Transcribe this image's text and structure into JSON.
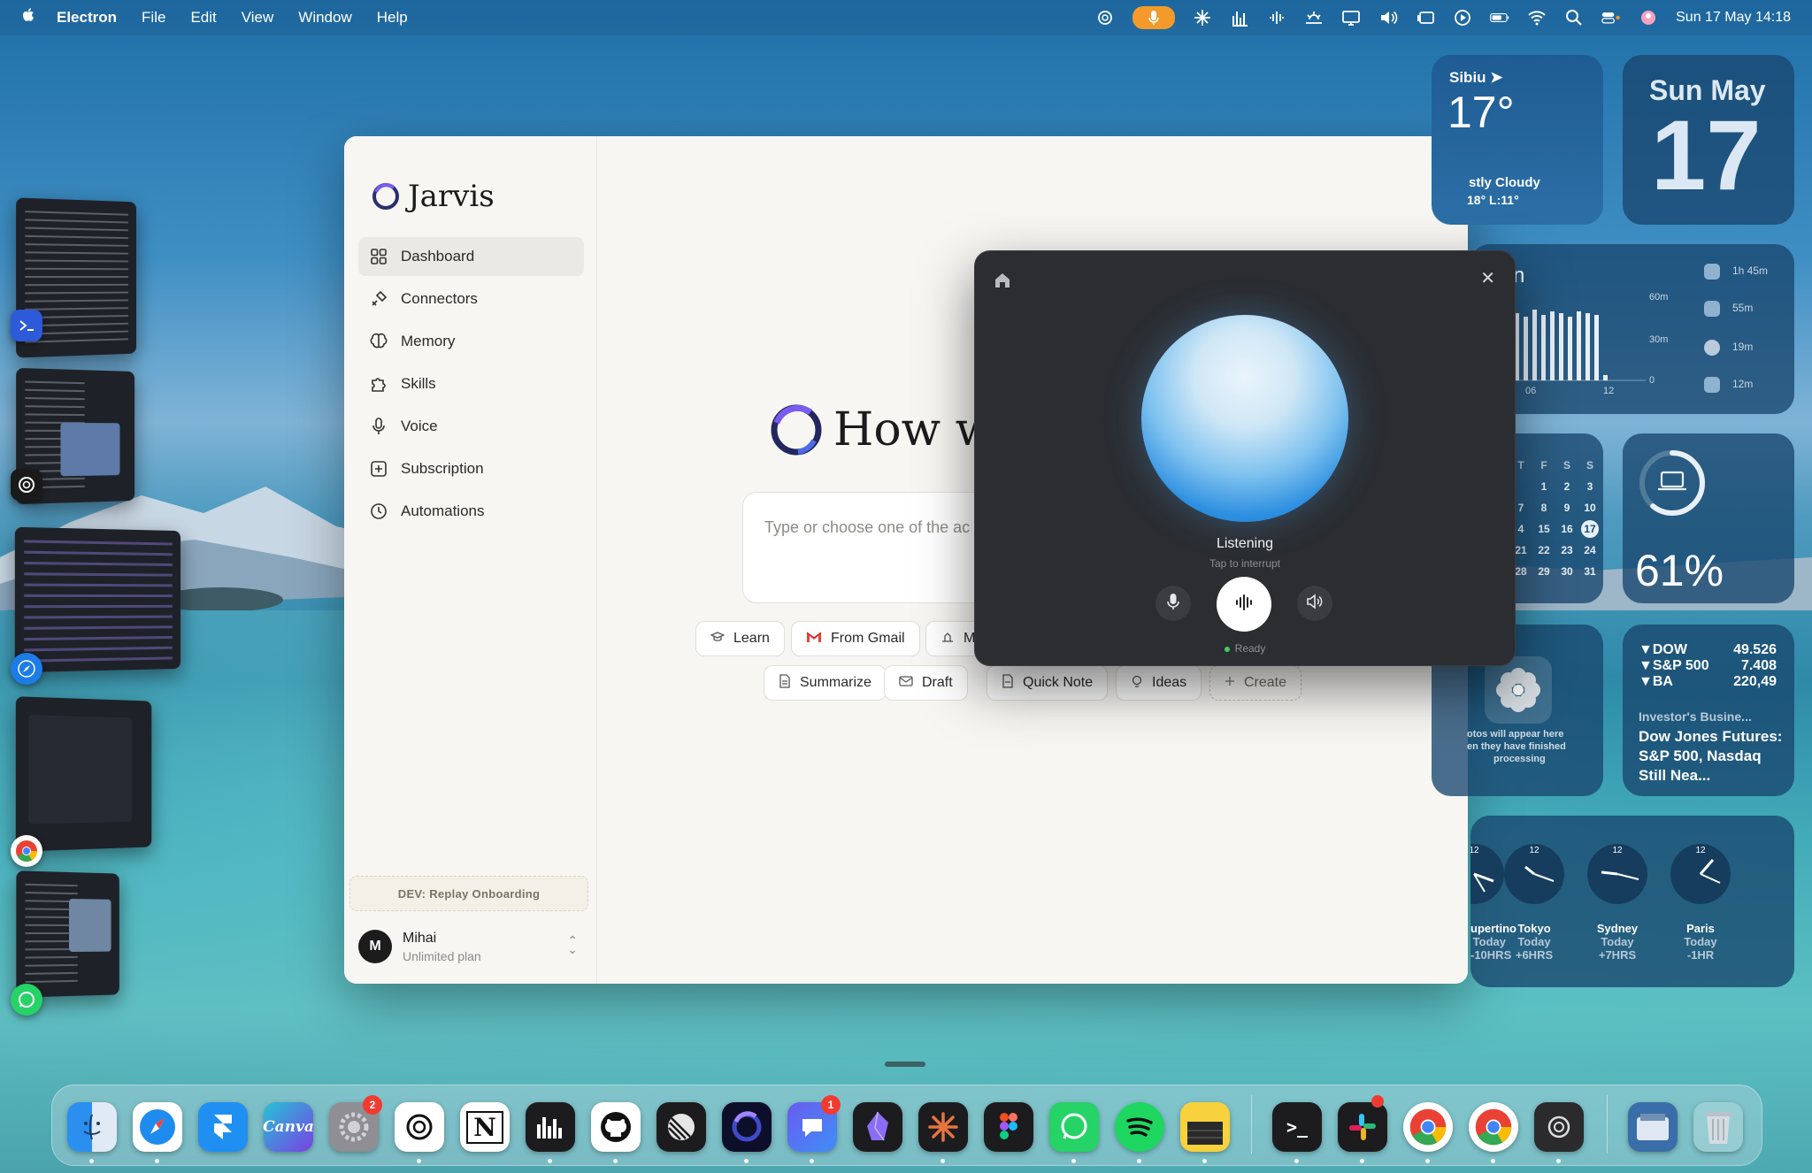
{
  "menubar": {
    "app": "Electron",
    "menus": [
      "File",
      "Edit",
      "View",
      "Window",
      "Help"
    ],
    "datetime": "Sun 17 May  14:18"
  },
  "sidebar": {
    "brand": "Jarvis",
    "items": [
      {
        "label": "Dashboard",
        "icon": "grid-icon"
      },
      {
        "label": "Connectors",
        "icon": "plug-icon"
      },
      {
        "label": "Memory",
        "icon": "brain-icon"
      },
      {
        "label": "Skills",
        "icon": "puzzle-icon"
      },
      {
        "label": "Voice",
        "icon": "microphone-icon"
      },
      {
        "label": "Subscription",
        "icon": "plus-square-icon"
      },
      {
        "label": "Automations",
        "icon": "clock-icon"
      }
    ],
    "dev_button": "DEV: Replay Onboarding",
    "user": {
      "initial": "M",
      "name": "Mihai",
      "plan": "Unlimited plan"
    }
  },
  "main": {
    "hero": "How wa",
    "input_placeholder": "Type or choose one of the ac floatingbar, just like a normal",
    "chips_row1": [
      "Learn",
      "From Gmail",
      "M"
    ],
    "chips_row2": [
      "Summarize",
      "Draft",
      "Quick Note",
      "Ideas",
      "Create"
    ]
  },
  "voice_panel": {
    "status": "Listening",
    "hint": "Tap to interrupt",
    "ready": "Ready"
  },
  "widgets": {
    "weather": {
      "city": "Sibiu",
      "temp": "17°",
      "cond": "stly Cloudy",
      "range": "18° L:11°"
    },
    "date": {
      "month": "Sun May",
      "day": "17"
    },
    "screentime": {
      "title": "n",
      "scale": [
        "60m",
        "30m",
        "0"
      ],
      "hours": [
        "06",
        "12"
      ],
      "apps": [
        "1h 45m",
        "55m",
        "19m",
        "12m"
      ]
    },
    "calendar": {
      "head": [
        "T",
        "F",
        "S",
        "S"
      ],
      "rows": [
        [
          "",
          "1",
          "2",
          "3"
        ],
        [
          "7",
          "8",
          "9",
          "10"
        ],
        [
          "4",
          "15",
          "16",
          "17"
        ],
        [
          "21",
          "22",
          "23",
          "24"
        ],
        [
          "28",
          "29",
          "30",
          "31"
        ]
      ],
      "today": "17"
    },
    "battery": {
      "pct": "61%",
      "level": 0.61
    },
    "photos": {
      "line1": "otos will appear here",
      "line2": "en they have finished",
      "line3": "processing"
    },
    "stocks": {
      "rows": [
        [
          "▼DOW",
          "49.526"
        ],
        [
          "▼S&P 500",
          "7.408"
        ],
        [
          "▼BA",
          "220,49"
        ]
      ],
      "source": "Investor's Busine...",
      "headline": "Dow Jones Futures: S&P 500, Nasdaq Still Nea..."
    },
    "clocks": [
      {
        "city": "upertino",
        "day": "Today",
        "off": "-10HRS"
      },
      {
        "city": "Tokyo",
        "day": "Today",
        "off": "+6HRS"
      },
      {
        "city": "Sydney",
        "day": "Today",
        "off": "+7HRS"
      },
      {
        "city": "Paris",
        "day": "Today",
        "off": "-1HR"
      }
    ]
  },
  "dock": {
    "canva": "Canva",
    "settings_badge": "2",
    "messenger_badge": "1",
    "notion": "N",
    "terminal": ">_"
  }
}
